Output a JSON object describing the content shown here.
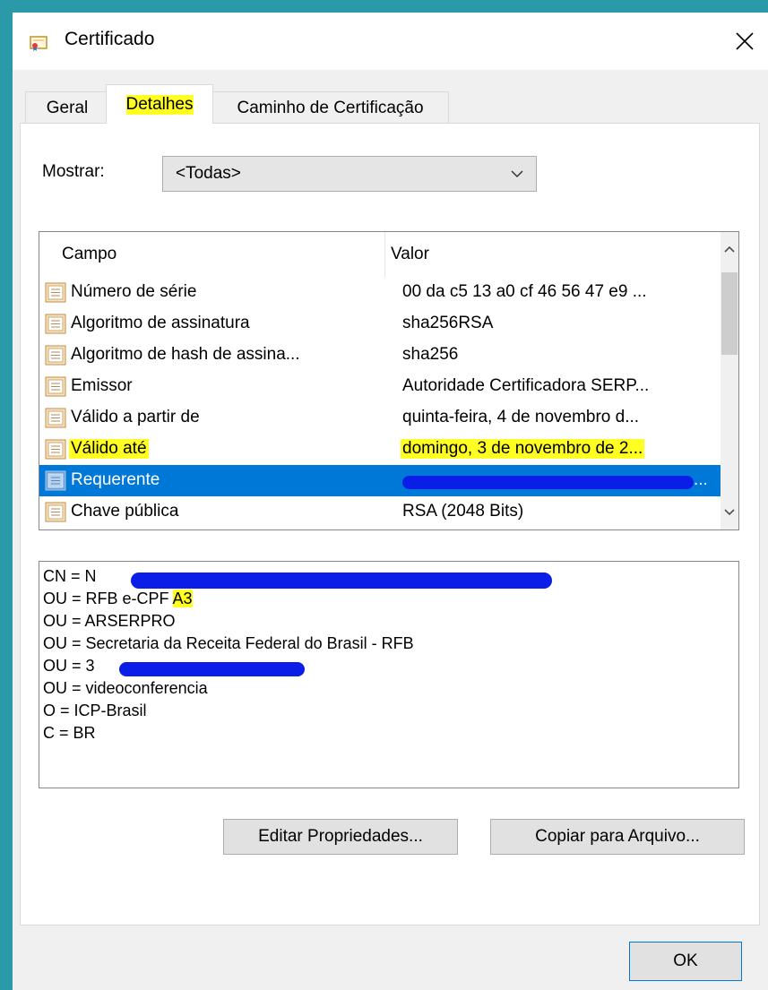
{
  "window": {
    "title": "Certificado",
    "close_glyph": "✕"
  },
  "tabs": [
    {
      "label": "Geral",
      "active": false
    },
    {
      "label": "Detalhes",
      "active": true
    },
    {
      "label": "Caminho de Certificação",
      "active": false
    }
  ],
  "show": {
    "label": "Mostrar:",
    "value": "<Todas>"
  },
  "fields_list": {
    "columns": [
      "Campo",
      "Valor"
    ],
    "rows": [
      {
        "field": "Número de série",
        "value": "00 da c5 13 a0 cf 46 56 47 e9 ..."
      },
      {
        "field": "Algoritmo de assinatura",
        "value": "sha256RSA"
      },
      {
        "field": "Algoritmo de hash de assina...",
        "value": "sha256"
      },
      {
        "field": "Emissor",
        "value": "Autoridade Certificadora SERP..."
      },
      {
        "field": "Válido a partir de",
        "value": "quinta-feira, 4 de novembro d..."
      },
      {
        "field": "Válido até",
        "value": "domingo, 3 de novembro de 2...",
        "highlighted": true
      },
      {
        "field": "Requerente",
        "value": "...",
        "selected": true,
        "redacted": true
      },
      {
        "field": "Chave pública",
        "value": "RSA (2048 Bits)"
      }
    ]
  },
  "details": {
    "cn": "CN = N",
    "ou_rfb_prefix": "OU = RFB e-CPF ",
    "ou_rfb_highlight": "A3",
    "ou_arserpro": "OU = ARSERPRO",
    "ou_secretaria": "OU = Secretaria da Receita Federal do Brasil - RFB",
    "ou_redacted": "OU = 3",
    "ou_video": "OU = videoconferencia",
    "o": "O = ICP-Brasil",
    "c": "C = BR"
  },
  "buttons": {
    "edit_properties": "Editar Propriedades...",
    "copy_to_file": "Copiar para Arquivo...",
    "ok": "OK"
  },
  "colors": {
    "highlight": "#ffff22",
    "selection": "#0078d7",
    "redaction": "#0a1ee8",
    "background": "#2a9aa8"
  }
}
